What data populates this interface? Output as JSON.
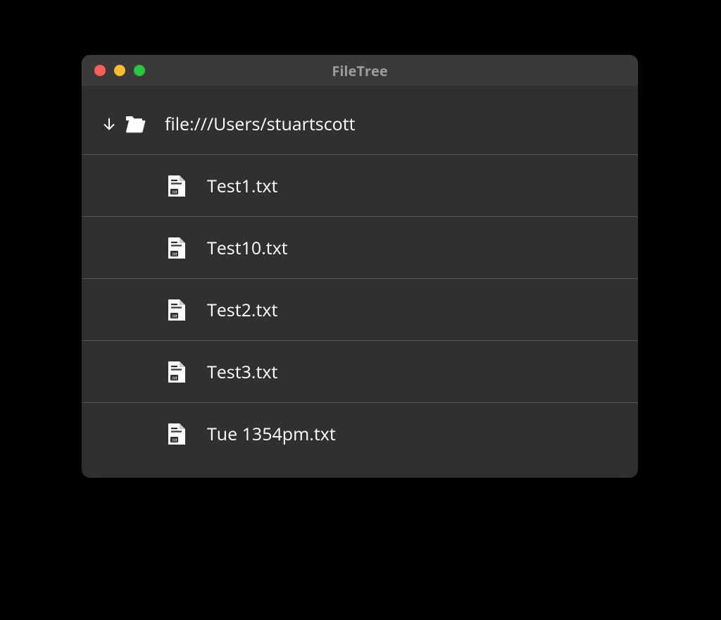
{
  "window": {
    "title": "FileTree"
  },
  "root": {
    "label": "file:///Users/stuartscott"
  },
  "files": [
    {
      "name": "Test1.txt"
    },
    {
      "name": "Test10.txt"
    },
    {
      "name": "Test2.txt"
    },
    {
      "name": "Test3.txt"
    },
    {
      "name": "Tue 1354pm.txt"
    }
  ]
}
